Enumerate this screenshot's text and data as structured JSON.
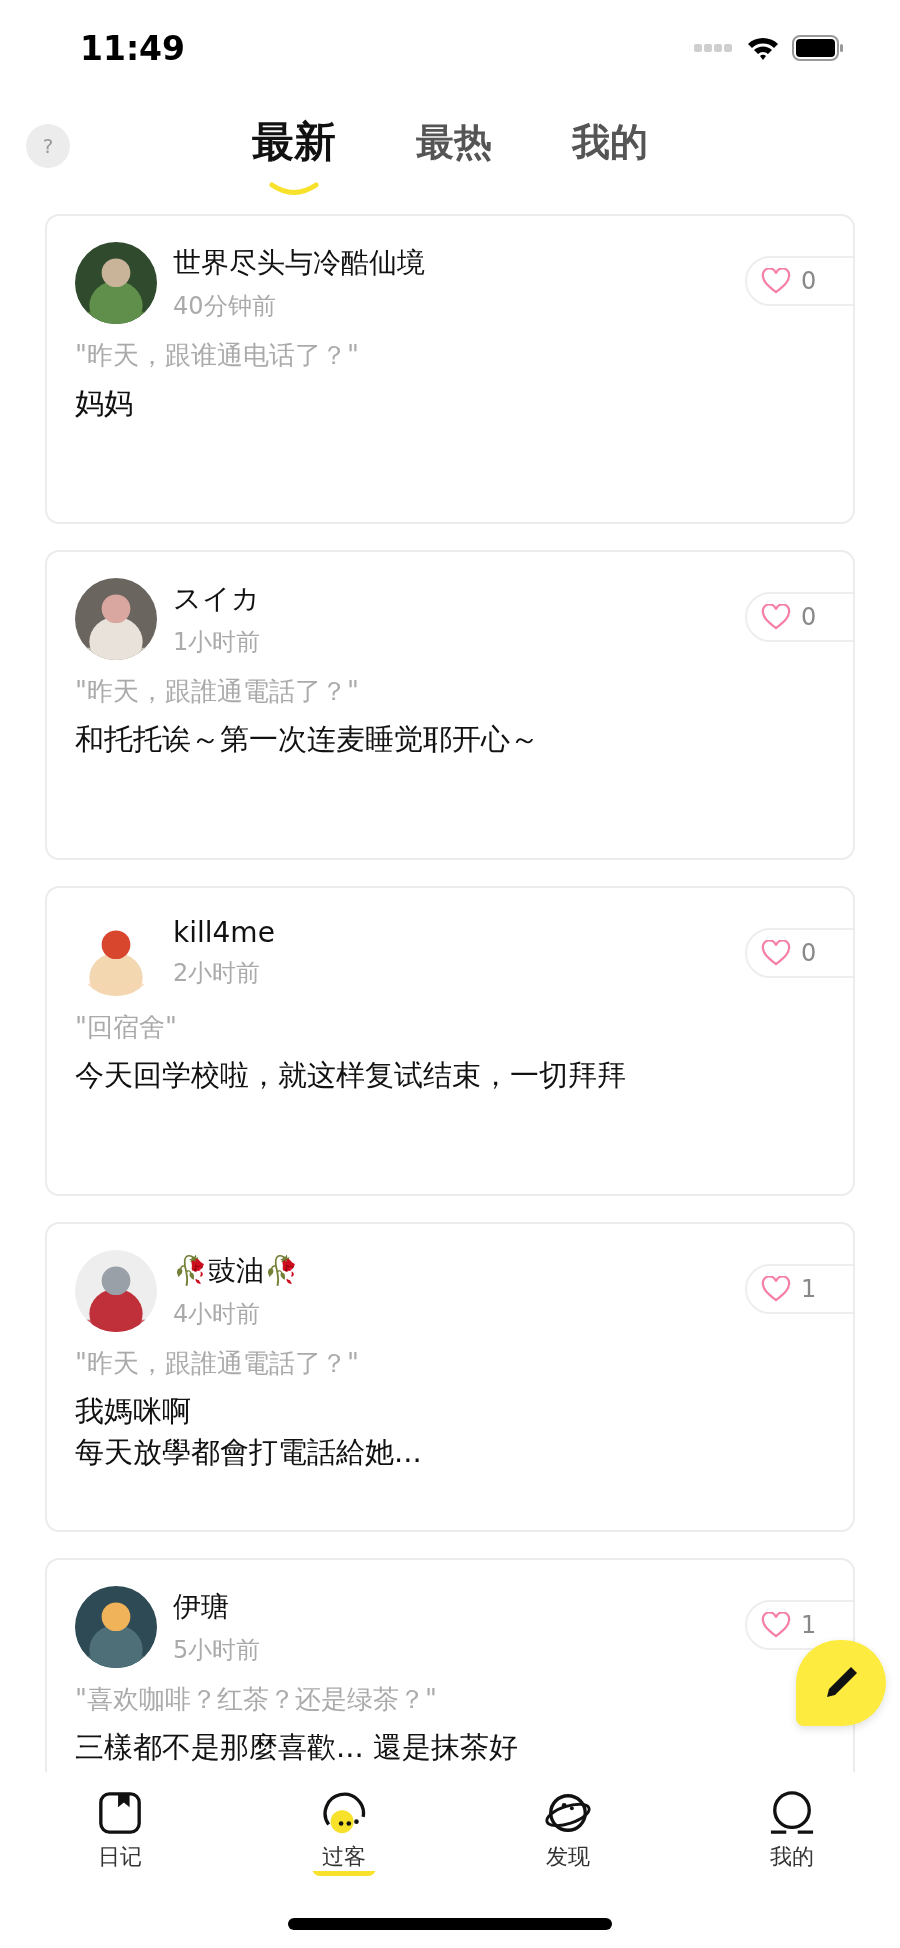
{
  "status_bar": {
    "time": "11:49"
  },
  "help_button": {
    "label": "?"
  },
  "tabs": [
    {
      "label": "最新",
      "selected": true
    },
    {
      "label": "最热",
      "selected": false
    },
    {
      "label": "我的",
      "selected": false
    }
  ],
  "posts": [
    {
      "name": "世界尽头与冷酷仙境",
      "time": "40分钟前",
      "question": "\"昨天，跟谁通电话了？\"",
      "body": "妈妈",
      "likes": "0"
    },
    {
      "name": "スイカ",
      "time": "1小时前",
      "question": "\"昨天，跟誰通電話了？\"",
      "body": "和托托诶～第一次连麦睡觉耶开心～",
      "likes": "0"
    },
    {
      "name": "kill4me",
      "time": "2小时前",
      "question": "\"回宿舍\"",
      "body": "今天回学校啦，就这样复试结束，一切拜拜",
      "likes": "0"
    },
    {
      "name": "🥀豉油🥀",
      "time": "4小时前",
      "question": "\"昨天，跟誰通電話了？\"",
      "body": [
        "我媽咪啊",
        "每天放學都會打電話給她..."
      ],
      "likes": "1"
    },
    {
      "name": "伊瑭",
      "time": "5小时前",
      "question": "\"喜欢咖啡？红茶？还是绿茶？\"",
      "body": "三樣都不是那麼喜歡... 還是抹茶好",
      "likes": "1"
    }
  ],
  "nav": [
    {
      "label": "日记",
      "kind": "diary",
      "selected": false
    },
    {
      "label": "过客",
      "kind": "passerby",
      "selected": true
    },
    {
      "label": "发现",
      "kind": "discover",
      "selected": false
    },
    {
      "label": "我的",
      "kind": "me",
      "selected": false
    }
  ]
}
